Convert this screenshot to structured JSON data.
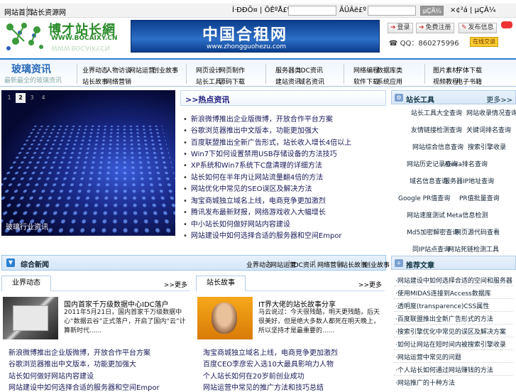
{
  "topbar": {
    "home": "网站首页",
    "sites": "站长资源网",
    "member": "Í·ÐÐÕ¤ | ÕÊºÅ£º",
    "password": "ÃÜÂë£º",
    "login_btn": "µÇÂ¼",
    "register": "×¢²á | µÇÂ¼"
  },
  "header": {
    "logo_text": "博才站长網",
    "logo_url": "WWW.BOCAIXY.CN",
    "banner_title": "中国合租网",
    "banner_url": "www.zhongguohezu.com",
    "login_label": "登录",
    "register_label": "免费注册",
    "post_label": "发布信息",
    "qq_line": "QQ：860275996",
    "qq_button": "在线交谈"
  },
  "nav": {
    "title": "玻璃资讯",
    "subtitle": "最新最全的玻璃资讯",
    "groups": [
      {
        "items": [
          "业界动态",
          "人物访谈",
          "网站运营",
          "创业故事",
          "站长故事",
          "网络营销"
        ]
      },
      {
        "items": [
          "网页设计",
          "网页制作",
          "站长工具",
          "源码下载"
        ]
      },
      {
        "items": [
          "服务器类",
          "IDC资讯",
          "建站资讯",
          "域名资讯"
        ]
      },
      {
        "items": [
          "网络编程",
          "数据库类",
          "软件下载",
          "系统应用"
        ]
      },
      {
        "items": [
          "图片素材",
          "字体下载",
          "视频教程",
          "电子书籍"
        ]
      }
    ]
  },
  "slider": {
    "pages": [
      "1",
      "2",
      "3",
      "4"
    ],
    "active_page": "2",
    "caption": "玻璃行业资讯"
  },
  "hot": {
    "title": ">>热点资讯",
    "items": [
      "新浪微博推出企业版微博，开放合作平台方案",
      "谷歌浏览器推出中文版本，功能更加强大",
      "百度联盟推出全新广告形式，站长收入增长4倍以上",
      "Win7下如何设置禁用USB存储设备的方法技巧",
      "XP系统和Win7系统下C盘清理的详细方法",
      "站长如何在半年内让网站流量翻4倍的方法",
      "网站优化中常见的SEO误区及解决方法",
      "淘宝商城独立域名上线，电商竞争更加激烈",
      "腾讯发布最新财报，网络游戏收入大幅增长",
      "中小站长如何做好网站内容建设",
      "网站建设中如何选择合适的服务器和空间Empor"
    ]
  },
  "tools": {
    "title": "站长工具",
    "more": "更多>>",
    "items": [
      "站长工具大全查询",
      "网站收录情况查询",
      "友情链接检测查询",
      "关键词排名查询",
      "网站综合信息查询",
      "搜索引擎收录",
      "网站历史记录查询",
      "Alexa排名查询",
      "域名信息查询",
      "服务器IP地址查询",
      "Google PR值查询",
      "PR值批量查询",
      "网站速度测试",
      "Meta信息检测",
      "Md5加密解密查询",
      "网页源代码查看",
      "同IP站点查询",
      "网站死链检测工具"
    ]
  },
  "news": {
    "title": "综合新闻",
    "tabs": [
      "业界动态",
      "网站运营",
      "IDC资讯",
      "网络营销",
      "站长故事",
      "创业故事"
    ]
  },
  "left_col": {
    "tab": "业界动态",
    "more": ">>更多",
    "feature_title": "国内首家千万级数据中心IDC落户",
    "feature_desc": "2011年5月21日，国内首家千万级数据中心“数据云谷”正式落户，开启了国内“云”计算新时代......",
    "items": [
      "新浪微博推出企业版微博，开放合作平台方案",
      "谷歌浏览器推出中文版本，功能更加强大",
      "站长如何做好网站内容建设",
      "网站建设中如何选择合适的服务器和空间Empor"
    ]
  },
  "right_col": {
    "tab": "站长故事",
    "more": ">>更多",
    "feature_title": "IT界大佬的站长故事分享",
    "feature_desc": "马云说过：今天很残酷，明天更残酷，后天很美好，但是绝大多数人都死在明天晚上，所以坚持才是最重要的......",
    "items": [
      "淘宝商城独立域名上线，电商竞争更加激烈",
      "百度CEO李彦宏入选10大最具影响力人物",
      "个人站长如何在20岁前创业成功",
      "网站运营中常见的推广方法和技巧总结"
    ]
  },
  "recommend": {
    "title": "推荐文章",
    "items": [
      "网站建设中如何选择合适的空间和服务器",
      "使用MIDAS连接到Access数据库",
      "透明度(transparence)CSS属性",
      "百度联盟推出全新广告形式的方法",
      "搜索引擎优化中常见的误区及解决方案",
      "如何让网站在短时间内被搜索引擎收录",
      "网站运营中常见的问题",
      "个人站长如何通过网站赚钱的方法",
      "网站推广的十种方法"
    ]
  }
}
